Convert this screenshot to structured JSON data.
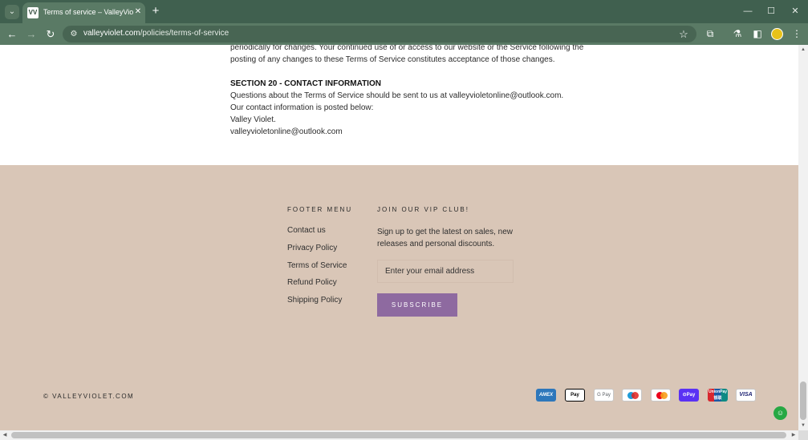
{
  "browser": {
    "tab": {
      "favicon_text": "VV",
      "title": "Terms of service – ValleyViolet",
      "close_glyph": "✕"
    },
    "new_tab_glyph": "+",
    "tab_menu_glyph": "⌄",
    "window_controls": {
      "minimize": "—",
      "maximize": "☐",
      "close": "✕"
    },
    "nav": {
      "back": "←",
      "forward": "→",
      "reload": "↻"
    },
    "url": {
      "domain": "valleyviolet.com",
      "path": "/policies/terms-of-service"
    },
    "icons": {
      "site_info": "⚙",
      "bookmark": "☆",
      "extensions": "⧉",
      "labs": "⚗",
      "side_panel": "◧",
      "menu": "⋮"
    }
  },
  "tos": {
    "lines_top": [
      "periodically for changes. Your continued use of or access to our website or the Service following the",
      "posting of any changes to these Terms of Service constitutes acceptance of those changes."
    ],
    "section_heading": "SECTION 20 - CONTACT INFORMATION",
    "lines_contact": [
      "Questions about the Terms of Service should be sent to us at valleyvioletonline@outlook.com.",
      "Our contact information is posted below:",
      "Valley Violet.",
      "valleyvioletonline@outlook.com"
    ]
  },
  "footer": {
    "menu_title": "FOOTER MENU",
    "menu_links": [
      "Contact us",
      "Privacy Policy",
      "Terms of Service",
      "Refund Policy",
      "Shipping Policy"
    ],
    "vip_title": "JOIN OUR VIP CLUB!",
    "vip_text": "Sign up to get the latest on sales, new releases and personal discounts.",
    "email_placeholder": "Enter your email address",
    "subscribe_label": "SUBSCRIBE",
    "copyright": "© VALLEYVIOLET.COM",
    "payment_methods": [
      {
        "name": "amex-icon",
        "label": "AMEX"
      },
      {
        "name": "apple-pay-icon",
        "label": " Pay"
      },
      {
        "name": "google-pay-icon",
        "label": "G Pay"
      },
      {
        "name": "maestro-icon",
        "label": ""
      },
      {
        "name": "mastercard-icon",
        "label": ""
      },
      {
        "name": "shop-pay-icon",
        "label": "⊙Pay"
      },
      {
        "name": "unionpay-icon",
        "label": "UnionPay 银联"
      },
      {
        "name": "visa-icon",
        "label": "VISA"
      }
    ]
  },
  "chat_widget_glyph": "☺",
  "colors": {
    "browser_tabbar": "#40604f",
    "browser_toolbar": "#5a7a65",
    "footer_bg": "#d9c6b7",
    "subscribe_bg": "#8e6aa0",
    "maestro_red": "#e2211c",
    "maestro_blue": "#1e9bd7",
    "mastercard_red": "#eb001b",
    "mastercard_orange": "#f79e1b"
  }
}
